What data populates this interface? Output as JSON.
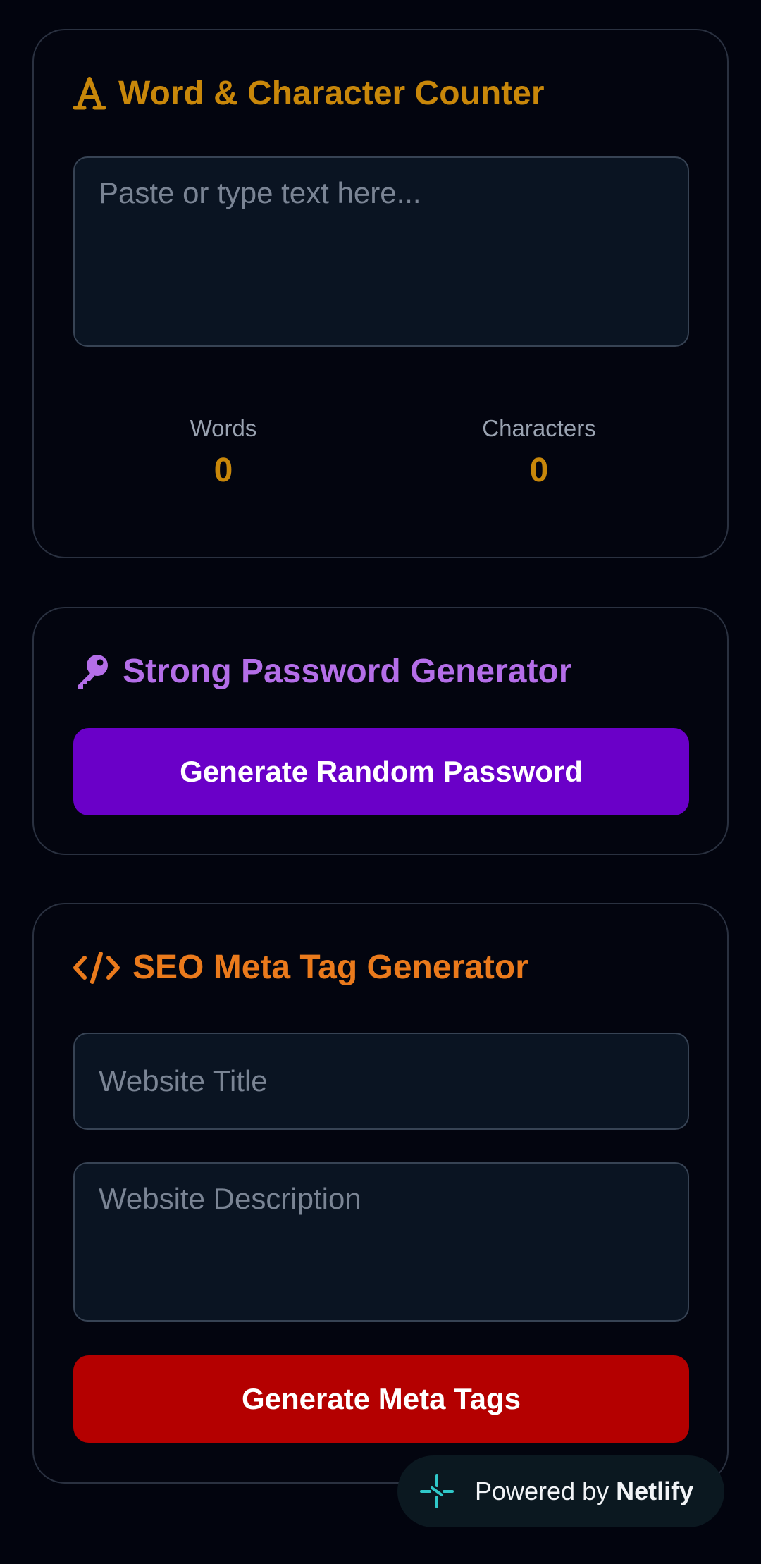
{
  "counter": {
    "title": "Word & Character Counter",
    "icon": "font-icon",
    "placeholder": "Paste or type text here...",
    "words_label": "Words",
    "words_value": "0",
    "chars_label": "Characters",
    "chars_value": "0"
  },
  "password": {
    "title": "Strong Password Generator",
    "icon": "key-icon",
    "button_label": "Generate Random Password"
  },
  "seo": {
    "title": "SEO Meta Tag Generator",
    "icon": "code-icon",
    "title_placeholder": "Website Title",
    "description_placeholder": "Website Description",
    "button_label": "Generate Meta Tags"
  },
  "badge": {
    "prefix": "Powered by",
    "brand": "Netlify"
  },
  "colors": {
    "background": "#02040e",
    "counter_accent": "#c8870a",
    "password_accent": "#b46ee8",
    "password_button": "#6a00c8",
    "seo_accent": "#ea7a1c",
    "seo_button": "#b40000"
  }
}
